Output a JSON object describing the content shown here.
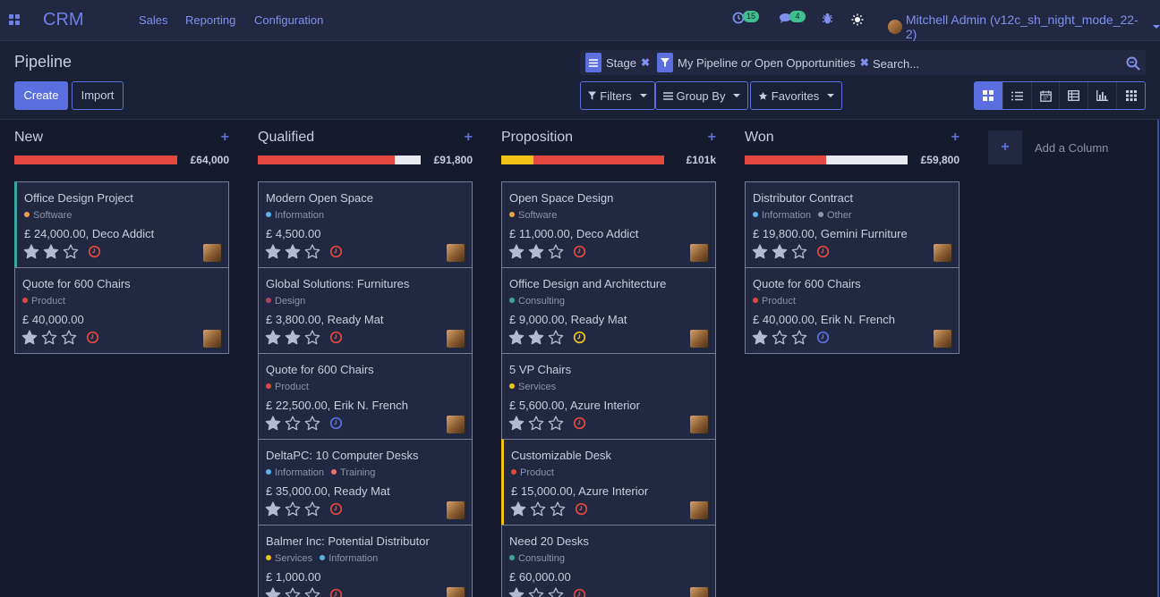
{
  "navbar": {
    "brand": "CRM",
    "menus": [
      "Sales",
      "Reporting",
      "Configuration"
    ],
    "activity_count": "15",
    "messages_count": "4",
    "user_name": "Mitchell Admin (v12c_sh_night_mode_22-2)"
  },
  "control_panel": {
    "title": "Pipeline",
    "create_label": "Create",
    "import_label": "Import",
    "facet_stage": "Stage",
    "facet_filter_a": "My Pipeline",
    "facet_filter_or": "or",
    "facet_filter_b": "Open Opportunities",
    "search_placeholder": "Search...",
    "filters_label": "Filters",
    "groupby_label": "Group By",
    "favorites_label": "Favorites",
    "views": [
      "kanban",
      "list",
      "calendar",
      "pivot",
      "graph",
      "cohort"
    ],
    "active_view": "kanban"
  },
  "kanban": {
    "add_column_label": "Add a Column",
    "columns": [
      {
        "title": "New",
        "total": "£64,000",
        "progress": {
          "yellow": 0,
          "red": 1.0
        },
        "cards": [
          {
            "title": "Office Design Project",
            "tags": [
              {
                "name": "Software",
                "color": "#f0a040"
              }
            ],
            "amount": "£ 24,000.00, Deco Addict",
            "stars": 2,
            "activity": "overdue",
            "strip": "teal"
          },
          {
            "title": "Quote for 600 Chairs",
            "tags": [
              {
                "name": "Product",
                "color": "#e2483f"
              }
            ],
            "amount": "£ 40,000.00",
            "stars": 1,
            "activity": "overdue",
            "strip": ""
          }
        ]
      },
      {
        "title": "Qualified",
        "total": "£91,800",
        "progress": {
          "yellow": 0,
          "red": 0.84
        },
        "cards": [
          {
            "title": "Modern Open Space",
            "tags": [
              {
                "name": "Information",
                "color": "#5bb4e8"
              }
            ],
            "amount": "£ 4,500.00",
            "stars": 2,
            "activity": "overdue",
            "strip": ""
          },
          {
            "title": "Global Solutions: Furnitures",
            "tags": [
              {
                "name": "Design",
                "color": "#b0455a"
              }
            ],
            "amount": "£ 3,800.00, Ready Mat",
            "stars": 2,
            "activity": "overdue",
            "strip": ""
          },
          {
            "title": "Quote for 600 Chairs",
            "tags": [
              {
                "name": "Product",
                "color": "#e2483f"
              }
            ],
            "amount": "£ 22,500.00, Erik N. French",
            "stars": 1,
            "activity": "planned",
            "strip": ""
          },
          {
            "title": "DeltaPC: 10 Computer Desks",
            "tags": [
              {
                "name": "Information",
                "color": "#5bb4e8"
              },
              {
                "name": "Training",
                "color": "#e87070"
              }
            ],
            "amount": "£ 35,000.00, Ready Mat",
            "stars": 1,
            "activity": "overdue",
            "strip": ""
          },
          {
            "title": "Balmer Inc: Potential Distributor",
            "tags": [
              {
                "name": "Services",
                "color": "#efc31a"
              },
              {
                "name": "Information",
                "color": "#5bb4e8"
              }
            ],
            "amount": "£ 1,000.00",
            "stars": 1,
            "activity": "overdue",
            "strip": ""
          }
        ]
      },
      {
        "title": "Proposition",
        "total": "£101k",
        "progress": {
          "yellow": 0.2,
          "red": 0.8
        },
        "cards": [
          {
            "title": "Open Space Design",
            "tags": [
              {
                "name": "Software",
                "color": "#f0a040"
              }
            ],
            "amount": "£ 11,000.00, Deco Addict",
            "stars": 2,
            "activity": "overdue",
            "strip": ""
          },
          {
            "title": "Office Design and Architecture",
            "tags": [
              {
                "name": "Consulting",
                "color": "#3aa8a0"
              }
            ],
            "amount": "£ 9,000.00, Ready Mat",
            "stars": 2,
            "activity": "today",
            "strip": ""
          },
          {
            "title": "5 VP Chairs",
            "tags": [
              {
                "name": "Services",
                "color": "#efc31a"
              }
            ],
            "amount": "£ 5,600.00, Azure Interior",
            "stars": 1,
            "activity": "overdue",
            "strip": ""
          },
          {
            "title": "Customizable Desk",
            "tags": [
              {
                "name": "Product",
                "color": "#e2483f"
              }
            ],
            "amount": "£ 15,000.00, Azure Interior",
            "stars": 1,
            "activity": "overdue",
            "strip": "yellow"
          },
          {
            "title": "Need 20 Desks",
            "tags": [
              {
                "name": "Consulting",
                "color": "#3aa8a0"
              }
            ],
            "amount": "£ 60,000.00",
            "stars": 1,
            "activity": "overdue",
            "strip": ""
          }
        ]
      },
      {
        "title": "Won",
        "total": "£59,800",
        "progress": {
          "yellow": 0,
          "red": 0.5
        },
        "cards": [
          {
            "title": "Distributor Contract",
            "tags": [
              {
                "name": "Information",
                "color": "#5bb4e8"
              },
              {
                "name": "Other",
                "color": "#8d93ac"
              }
            ],
            "amount": "£ 19,800.00, Gemini Furniture",
            "stars": 2,
            "activity": "overdue",
            "strip": ""
          },
          {
            "title": "Quote for 600 Chairs",
            "tags": [
              {
                "name": "Product",
                "color": "#e2483f"
              }
            ],
            "amount": "£ 40,000.00, Erik N. French",
            "stars": 1,
            "activity": "planned",
            "strip": ""
          }
        ]
      }
    ]
  },
  "colors": {
    "accent": "#5b6fe0",
    "overdue": "#e2483f",
    "today": "#efc31a",
    "planned": "#5b6fe0",
    "star_filled": "#b4bad1",
    "star_empty": "#b4bad1"
  }
}
